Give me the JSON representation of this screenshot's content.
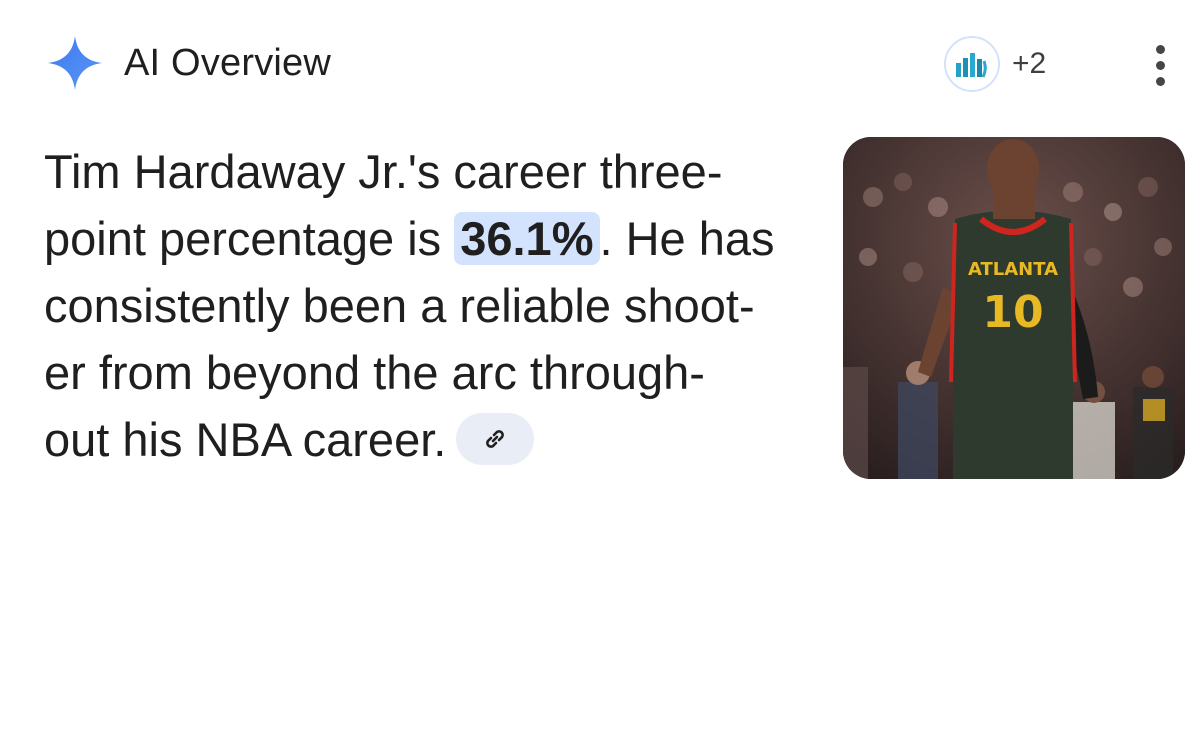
{
  "header": {
    "title": "AI Overview",
    "sources_count": "+2"
  },
  "answer": {
    "line1": "Tim Hardaway Jr.'s career three-",
    "line2_pre": "point percentage is ",
    "highlight": "36.1%",
    "line2_post": ". He has",
    "line3": "consistently been a reliable shoot-",
    "line4": "er from beyond the arc through-",
    "line5": "out his NBA career."
  },
  "image": {
    "jersey_text": "ATLANTA",
    "jersey_number": "10"
  },
  "colors": {
    "accent_blue": "#4a86f2",
    "highlight_bg": "#d3e3fd",
    "chip_bg": "#e9eef6",
    "jersey_dark": "#2f3a2f",
    "jersey_trim": "#d0251f",
    "jersey_gold": "#e8b923"
  },
  "icons": {
    "sparkle": "gemini-sparkle-icon",
    "source": "bar-chart-logo-icon",
    "more": "more-vertical-icon",
    "link": "link-icon"
  }
}
